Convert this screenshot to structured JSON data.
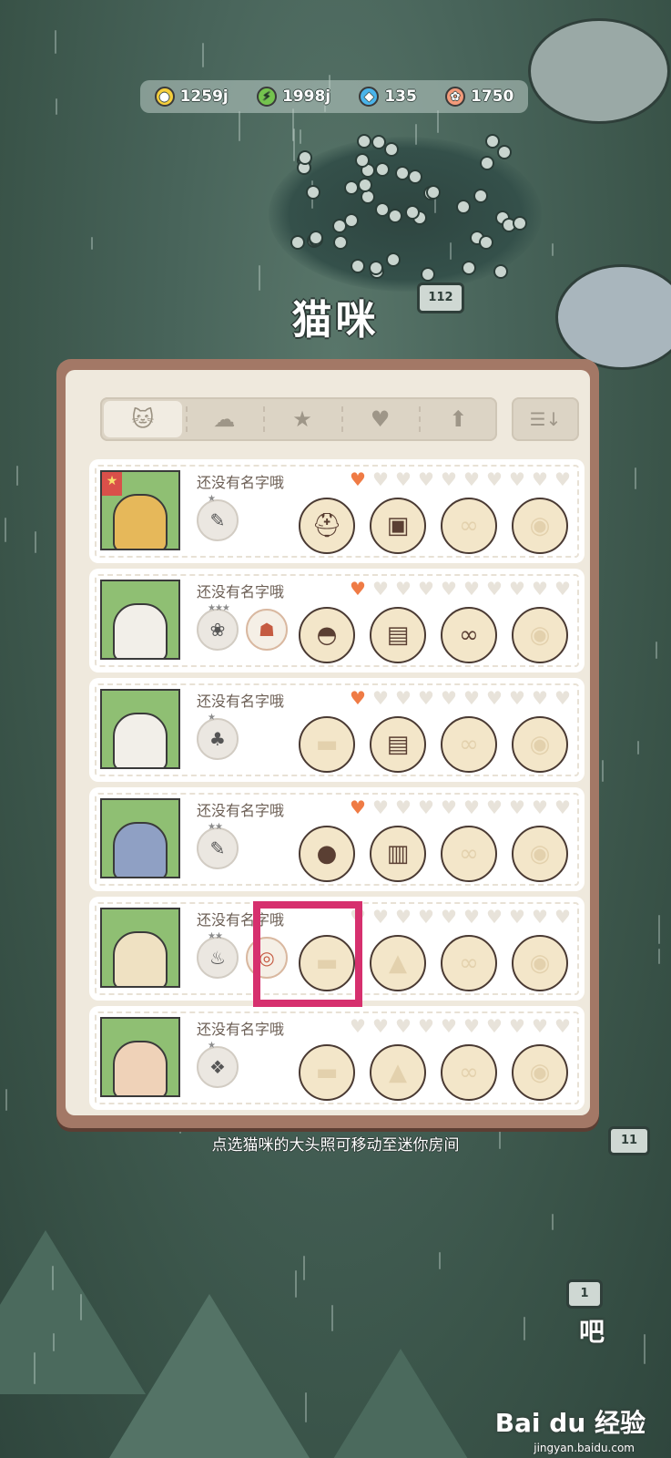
{
  "resources": [
    {
      "icon": "coin-icon",
      "glyph": "●",
      "value": "1259j"
    },
    {
      "icon": "energy-icon",
      "glyph": "⚡",
      "value": "1998j"
    },
    {
      "icon": "gem-icon",
      "glyph": "◆",
      "value": "135"
    },
    {
      "icon": "fish-icon",
      "glyph": "✿",
      "value": "1750"
    }
  ],
  "title": "猫咪",
  "tabs": [
    {
      "name": "tab-cats",
      "glyph": "🐱",
      "icon": "cat-icon"
    },
    {
      "name": "tab-chef",
      "glyph": "☁",
      "icon": "chef-hat-icon"
    },
    {
      "name": "tab-favorites",
      "glyph": "★",
      "icon": "star-icon"
    },
    {
      "name": "tab-affection",
      "glyph": "♥",
      "icon": "heart-icon"
    },
    {
      "name": "tab-level",
      "glyph": "⬆",
      "icon": "arrow-up-icon"
    }
  ],
  "sort": {
    "glyph": "☰↓",
    "icon": "sort-icon"
  },
  "cats": [
    {
      "name": "还没有名字哦",
      "hearts": 1,
      "fur": "#e6b85a",
      "starred": true,
      "skills": [
        {
          "icon": "skill-icon",
          "glyph": "✎",
          "stars": "★"
        }
      ],
      "equipment": [
        {
          "glyph": "⛑",
          "has": true
        },
        {
          "glyph": "▣",
          "has": true
        },
        {
          "glyph": "∞",
          "has": false
        },
        {
          "glyph": "◉",
          "has": false
        }
      ]
    },
    {
      "name": "还没有名字哦",
      "hearts": 1,
      "fur": "#f2efe9",
      "starred": false,
      "skills": [
        {
          "icon": "cat-skill-icon",
          "glyph": "❀",
          "stars": "★★★"
        },
        {
          "icon": "balloon-item-icon",
          "glyph": "☗",
          "stars": ""
        }
      ],
      "equipment": [
        {
          "glyph": "◓",
          "has": true
        },
        {
          "glyph": "▤",
          "has": true
        },
        {
          "glyph": "∞",
          "has": true
        },
        {
          "glyph": "◉",
          "has": false
        }
      ]
    },
    {
      "name": "还没有名字哦",
      "hearts": 1,
      "fur": "#f2efe9",
      "starred": false,
      "skills": [
        {
          "icon": "broccoli-skill-icon",
          "glyph": "♣",
          "stars": "★"
        }
      ],
      "equipment": [
        {
          "glyph": "▬",
          "has": false
        },
        {
          "glyph": "▤",
          "has": true
        },
        {
          "glyph": "∞",
          "has": false
        },
        {
          "glyph": "◉",
          "has": false
        }
      ]
    },
    {
      "name": "还没有名字哦",
      "hearts": 1,
      "fur": "#8fa0c4",
      "starred": false,
      "skills": [
        {
          "icon": "carrot-skill-icon",
          "glyph": "✎",
          "stars": "★★"
        }
      ],
      "equipment": [
        {
          "glyph": "●",
          "has": true
        },
        {
          "glyph": "▥",
          "has": true
        },
        {
          "glyph": "∞",
          "has": false
        },
        {
          "glyph": "◉",
          "has": false
        }
      ]
    },
    {
      "name": "还没有名字哦",
      "hearts": 0,
      "fur": "#efe1c2",
      "starred": false,
      "skills": [
        {
          "icon": "bottle-skill-icon",
          "glyph": "♨",
          "stars": "★★"
        },
        {
          "icon": "ring-item-icon",
          "glyph": "◎",
          "stars": ""
        }
      ],
      "equipment": [
        {
          "glyph": "▬",
          "has": false
        },
        {
          "glyph": "▲",
          "has": false
        },
        {
          "glyph": "∞",
          "has": false
        },
        {
          "glyph": "◉",
          "has": false
        }
      ]
    },
    {
      "name": "还没有名字哦",
      "hearts": 0,
      "fur": "#efd2b8",
      "starred": false,
      "skills": [
        {
          "icon": "pineapple-skill-icon",
          "glyph": "❖",
          "stars": "★"
        }
      ],
      "equipment": [
        {
          "glyph": "▬",
          "has": false
        },
        {
          "glyph": "▲",
          "has": false
        },
        {
          "glyph": "∞",
          "has": false
        },
        {
          "glyph": "◉",
          "has": false
        }
      ]
    }
  ],
  "hint": "点选猫咪的大头照可移动至迷你房间",
  "bubble": "吧",
  "watermark": {
    "logo": "Bai du 经验",
    "url": "jingyan.baidu.com"
  },
  "signs": {
    "flowerbed": "112",
    "lower_right": "11",
    "bottom_right": "1"
  }
}
